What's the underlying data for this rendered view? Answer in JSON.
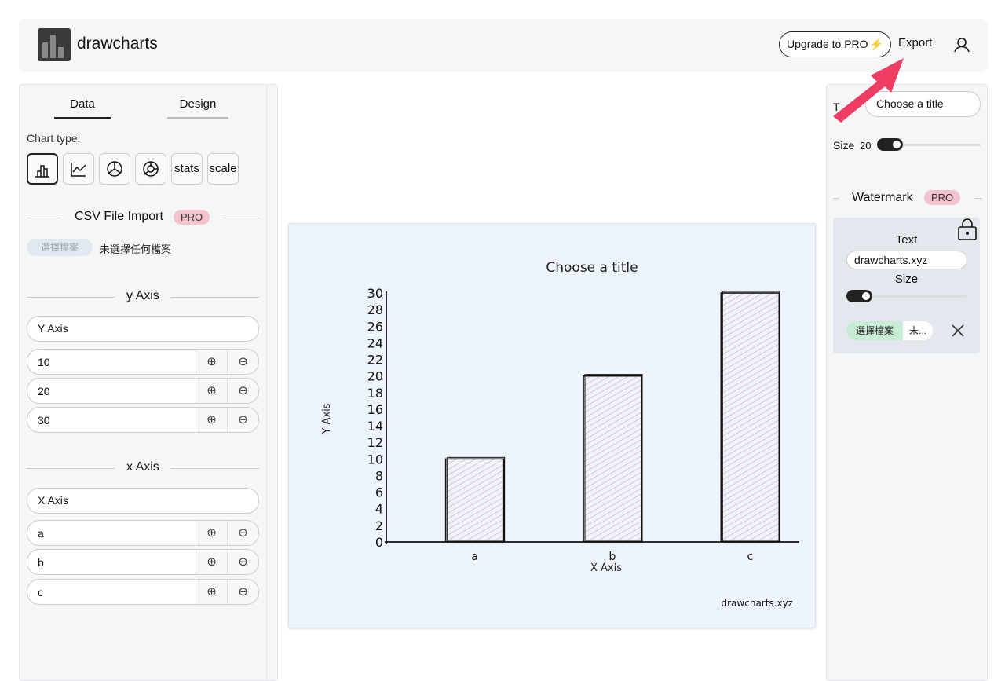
{
  "app": {
    "name": "drawcharts"
  },
  "header": {
    "upgrade_label": "Upgrade to PRO",
    "upgrade_icon": "⚡",
    "export_label": "Export"
  },
  "left": {
    "tabs": [
      {
        "label": "Data"
      },
      {
        "label": "Design"
      }
    ],
    "chart_type_label": "Chart type:",
    "chart_types": [
      {
        "icon": "bar-chart-icon"
      },
      {
        "icon": "line-chart-icon"
      },
      {
        "icon": "pie-chart-icon"
      },
      {
        "icon": "donut-chart-icon"
      },
      {
        "label": "stats"
      },
      {
        "label": "scale"
      }
    ],
    "csv": {
      "title": "CSV File Import",
      "badge": "PRO",
      "file_button": "選擇檔案",
      "file_status": "未選擇任何檔案"
    },
    "y_axis": {
      "title": "y Axis",
      "label_value": "Y Axis",
      "values": [
        "10",
        "20",
        "30"
      ]
    },
    "x_axis": {
      "title": "x Axis",
      "label_value": "X Axis",
      "values": [
        "a",
        "b",
        "c"
      ]
    }
  },
  "right": {
    "title_label": "T",
    "title_placeholder": "Choose a title",
    "size_label": "Size",
    "size_value": "20",
    "watermark": {
      "title": "Watermark",
      "badge": "PRO",
      "text_label": "Text",
      "text_value": "drawcharts.xyz",
      "size_label": "Size",
      "file_button": "選擇檔案",
      "file_status": "未..."
    }
  },
  "chart_data": {
    "type": "bar",
    "title": "Choose a title",
    "xlabel": "X Axis",
    "ylabel": "Y Axis",
    "categories": [
      "a",
      "b",
      "c"
    ],
    "values": [
      10,
      20,
      30
    ],
    "ylim": [
      0,
      30
    ],
    "yticks": [
      "0",
      "2",
      "4",
      "6",
      "8",
      "10",
      "12",
      "14",
      "16",
      "18",
      "20",
      "22",
      "24",
      "26",
      "28",
      "30"
    ],
    "watermark": "drawcharts.xyz",
    "bar_color": "#e8a0ae"
  }
}
